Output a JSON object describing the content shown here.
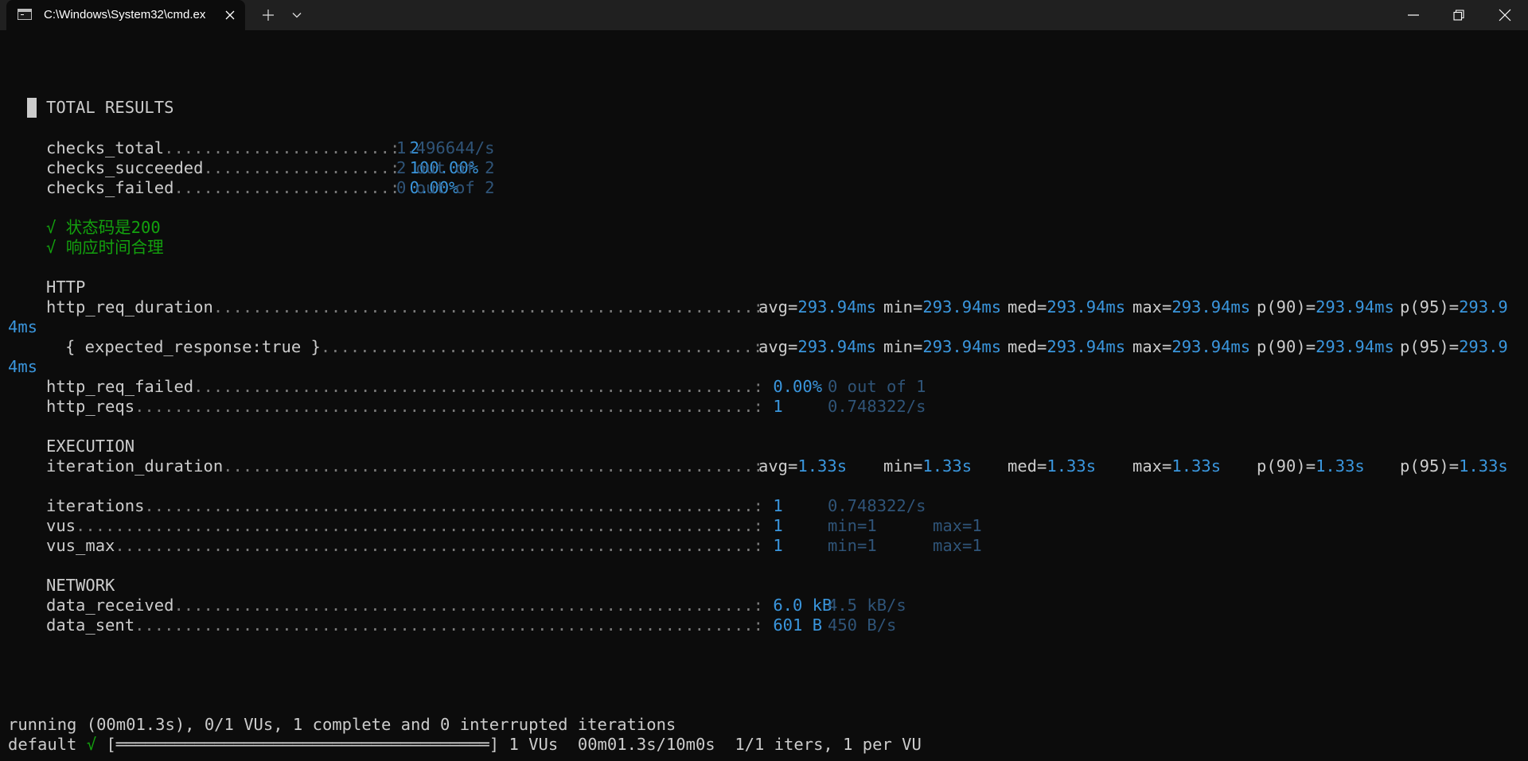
{
  "window": {
    "tab_title": "C:\\Windows\\System32\\cmd.ex",
    "icons": {
      "tab": "terminal-icon",
      "close_tab": "close-icon",
      "new_tab": "plus-icon",
      "dropdown": "chevron-down-icon",
      "minimize": "minimize-icon",
      "maximize": "restore-icon",
      "close": "close-icon"
    }
  },
  "colors": {
    "background": "#0c0c0c",
    "text": "#cccccc",
    "value": "#3a96dd",
    "secondary": "#2f5478",
    "check": "#13a10e"
  },
  "results": {
    "header": "TOTAL RESULTS",
    "checks": [
      {
        "name": "checks_total",
        "dots": ".......................:",
        "value": "2",
        "extra": "1.496644/s"
      },
      {
        "name": "checks_succeeded",
        "dots": "...................:",
        "value": "100.00%",
        "extra": "2 out of 2"
      },
      {
        "name": "checks_failed",
        "dots": "......................:",
        "value": "0.00%",
        "extra": "0 out of 2"
      }
    ],
    "assertions": [
      {
        "mark": "√",
        "label": "状态码是200"
      },
      {
        "mark": "√",
        "label": "响应时间合理"
      }
    ],
    "http": {
      "header": "HTTP",
      "req_duration": {
        "name": "http_req_duration",
        "dots": ".......................................................:",
        "avg": "293.94ms",
        "min": "293.94ms",
        "med": "293.94ms",
        "max": "293.94ms",
        "p90": "293.94ms",
        "p95_head": "293.9",
        "p95_tail": "4ms"
      },
      "expected": {
        "name": "{ expected_response:true }",
        "dots": "............................................:",
        "avg": "293.94ms",
        "min": "293.94ms",
        "med": "293.94ms",
        "max": "293.94ms",
        "p90": "293.94ms",
        "p95_head": "293.9",
        "p95_tail": "4ms"
      },
      "req_failed": {
        "name": "http_req_failed",
        "dots": ".........................................................:",
        "value": "0.00%",
        "extra": "0 out of 1"
      },
      "reqs": {
        "name": "http_reqs",
        "dots": "...............................................................:",
        "value": "1",
        "extra": "0.748322/s"
      }
    },
    "execution": {
      "header": "EXECUTION",
      "iteration_duration": {
        "name": "iteration_duration",
        "dots": "......................................................:",
        "avg": "1.33s",
        "min": "1.33s",
        "med": "1.33s",
        "max": "1.33s",
        "p90": "1.33s",
        "p95": "1.33s"
      },
      "iterations": {
        "name": "iterations",
        "dots": "..............................................................:",
        "value": "1",
        "extra": "0.748322/s"
      },
      "vus": {
        "name": "vus",
        "dots": ".....................................................................:",
        "value": "1",
        "extra1": "min=1",
        "extra2": "max=1"
      },
      "vus_max": {
        "name": "vus_max",
        "dots": ".................................................................:",
        "value": "1",
        "extra1": "min=1",
        "extra2": "max=1"
      }
    },
    "network": {
      "header": "NETWORK",
      "received": {
        "name": "data_received",
        "dots": "...........................................................:",
        "value": "6.0 kB",
        "extra": "4.5 kB/s"
      },
      "sent": {
        "name": "data_sent",
        "dots": "...............................................................:",
        "value": "601 B",
        "extra": "450 B/s"
      }
    }
  },
  "status": {
    "running": "running (00m01.3s), 0/1 VUs, 1 complete and 0 interrupted iterations",
    "scenario": "default",
    "check": "√",
    "progress_bar": "[══════════════════════════════════════]",
    "progress_fraction": 1.0,
    "summary": "1 VUs  00m01.3s/10m0s  1/1 iters, 1 per VU"
  }
}
